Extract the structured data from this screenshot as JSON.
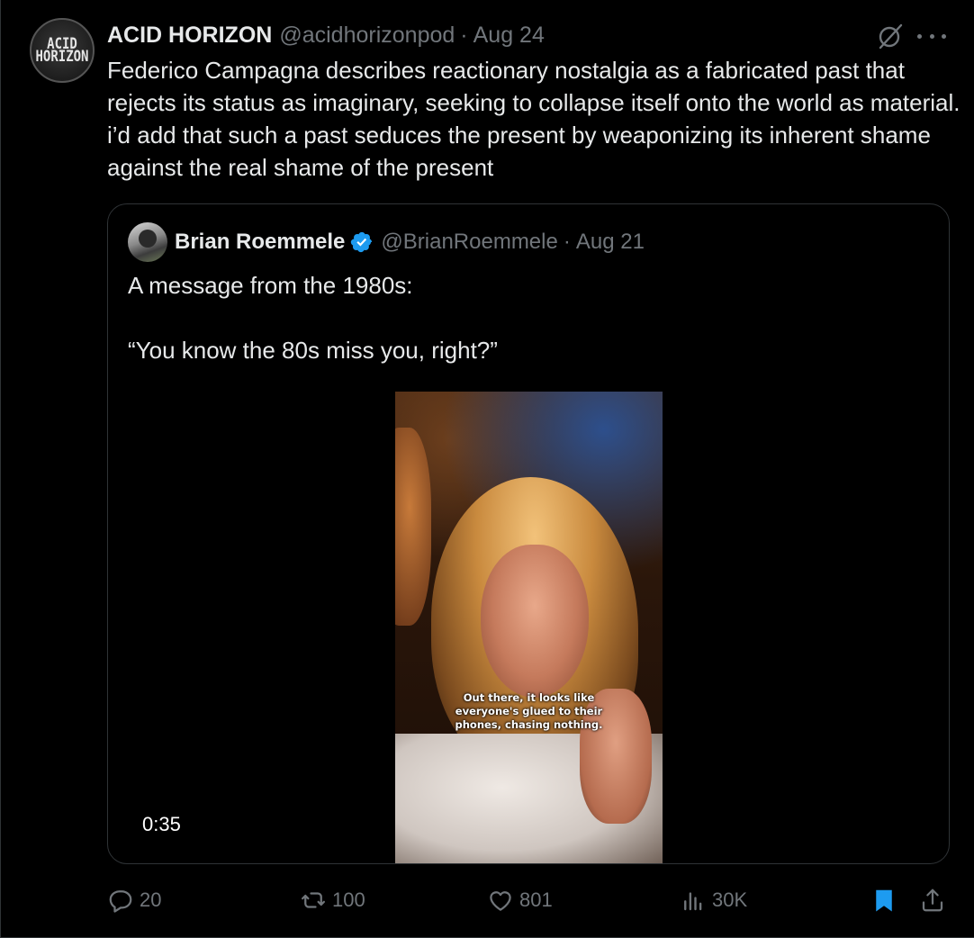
{
  "tweet": {
    "avatar_text": [
      "ACID",
      "HORIZON"
    ],
    "display_name": "ACID HORIZON",
    "handle": "@acidhorizonpod",
    "separator": "·",
    "date": "Aug 24",
    "text": "Federico Campagna describes reactionary nostalgia as a fabricated past that rejects its status as imaginary, seeking to collapse itself onto the world as material. i’d add that such a past seduces the present by weaponizing its inherent shame against the real shame of the present",
    "icons": {
      "grok": "grok-icon",
      "more": "more-icon"
    }
  },
  "quote": {
    "display_name": "Brian Roemmele",
    "verified": true,
    "handle": "@BrianRoemmele",
    "separator": "·",
    "date": "Aug 21",
    "line1": "A message from the 1980s:",
    "line2": "“You know the 80s miss you, right?”",
    "video": {
      "caption_lines": [
        "Out there, it looks like",
        "everyone's glued to their",
        "phones, chasing nothing."
      ],
      "duration": "0:35"
    }
  },
  "actions": {
    "reply": {
      "icon": "reply-icon",
      "count": "20"
    },
    "repost": {
      "icon": "repost-icon",
      "count": "100"
    },
    "like": {
      "icon": "heart-icon",
      "count": "801"
    },
    "views": {
      "icon": "views-icon",
      "count": "30K"
    },
    "bookmark": {
      "icon": "bookmark-icon"
    },
    "share": {
      "icon": "share-icon"
    }
  },
  "colors": {
    "background": "#000000",
    "text_primary": "#e7e9ea",
    "text_secondary": "#71767b",
    "border": "#2f3336",
    "accent_blue": "#1d9bf0"
  }
}
